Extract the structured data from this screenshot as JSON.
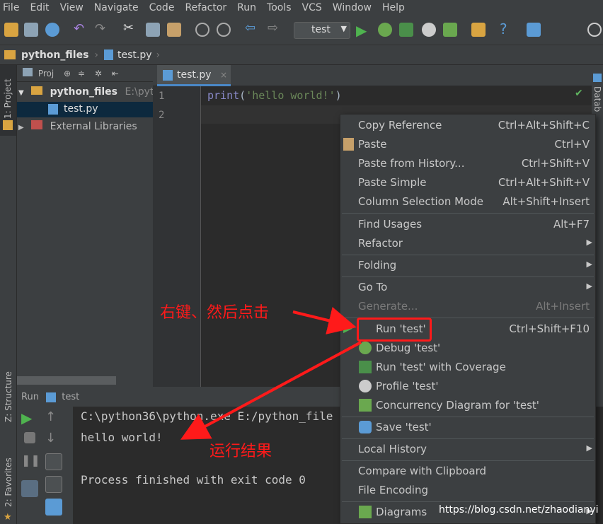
{
  "menubar": [
    "File",
    "Edit",
    "View",
    "Navigate",
    "Code",
    "Refactor",
    "Run",
    "Tools",
    "VCS",
    "Window",
    "Help"
  ],
  "toolbar": {
    "run_config": "test"
  },
  "navbar": {
    "project": "python_files",
    "file": "test.py"
  },
  "side_tabs": {
    "project": "1: Project",
    "structure": "Z: Structure",
    "favorites": "2: Favorites",
    "database": "Datab"
  },
  "project_panel": {
    "header": "Proj",
    "root": {
      "name": "python_files",
      "path": "E:\\pyt"
    },
    "file": "test.py",
    "external": "External Libraries"
  },
  "editor": {
    "tab": "test.py",
    "lines": [
      "1",
      "2"
    ],
    "code_line1": {
      "func": "print",
      "open": "(",
      "string": "'hello world!'",
      "close": ")"
    }
  },
  "run_panel": {
    "label": "Run",
    "config": "test",
    "output": [
      "C:\\python36\\python.exe E:/python_file",
      "hello world!",
      "",
      "Process finished with exit code 0"
    ]
  },
  "context_menu": [
    {
      "label": "Copy Reference",
      "shortcut": "Ctrl+Alt+Shift+C"
    },
    {
      "label": "Paste",
      "shortcut": "Ctrl+V",
      "icon": "paste-icon"
    },
    {
      "label": "Paste from History...",
      "shortcut": "Ctrl+Shift+V"
    },
    {
      "label": "Paste Simple",
      "shortcut": "Ctrl+Alt+Shift+V"
    },
    {
      "label": "Column Selection Mode",
      "shortcut": "Alt+Shift+Insert"
    },
    {
      "label": "Find Usages",
      "shortcut": "Alt+F7"
    },
    {
      "label": "Refactor",
      "submenu": true
    },
    {
      "label": "Folding",
      "submenu": true
    },
    {
      "label": "Go To",
      "submenu": true
    },
    {
      "label": "Generate...",
      "shortcut": "Alt+Insert",
      "disabled": true
    },
    {
      "label": "Run 'test'",
      "shortcut": "Ctrl+Shift+F10",
      "icon": "run-icon"
    },
    {
      "label": "Debug 'test'",
      "icon": "debug-icon"
    },
    {
      "label": "Run 'test' with Coverage",
      "icon": "coverage-icon"
    },
    {
      "label": "Profile 'test'",
      "icon": "profile-icon"
    },
    {
      "label": "Concurrency Diagram for  'test'",
      "icon": "concurrency-icon"
    },
    {
      "label": "Save 'test'",
      "icon": "python-icon"
    },
    {
      "label": "Local History",
      "submenu": true
    },
    {
      "label": "Compare with Clipboard"
    },
    {
      "label": "File Encoding"
    },
    {
      "label": "Diagrams",
      "icon": "diagrams-icon",
      "submenu": true
    }
  ],
  "annotations": {
    "right_click": "右键、然后点击",
    "result": "运行结果"
  },
  "watermark": "https://blog.csdn.net/zhaodianyi",
  "colors": {
    "highlight": "#ff1a1a",
    "accent": "#4a88c7",
    "run_green": "#4fb34f"
  }
}
